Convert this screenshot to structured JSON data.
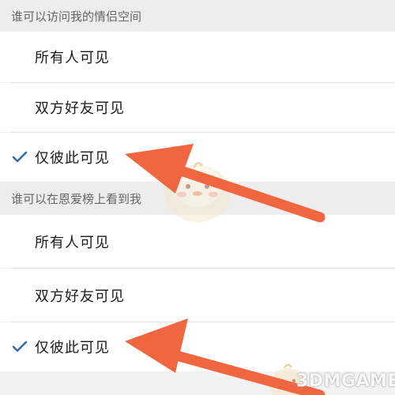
{
  "sections": [
    {
      "header": "谁可以访问我的情侣空间",
      "options": [
        {
          "label": "所有人可见",
          "selected": false
        },
        {
          "label": "双方好友可见",
          "selected": false
        },
        {
          "label": "仅彼此可见",
          "selected": true
        }
      ]
    },
    {
      "header": "谁可以在恩爱榜上看到我",
      "options": [
        {
          "label": "所有人可见",
          "selected": false
        },
        {
          "label": "双方好友可见",
          "selected": false
        },
        {
          "label": "仅彼此可见",
          "selected": true
        }
      ]
    }
  ],
  "watermark": "3DMGAME",
  "colors": {
    "check": "#2d6fbd",
    "arrow": "#f0673f",
    "header_bg": "#ededed",
    "row_bg": "#ffffff"
  },
  "icons": {
    "check": "checkmark-icon",
    "arrow": "red-arrow-annotation",
    "mascot": "chick-mascot-icon"
  }
}
